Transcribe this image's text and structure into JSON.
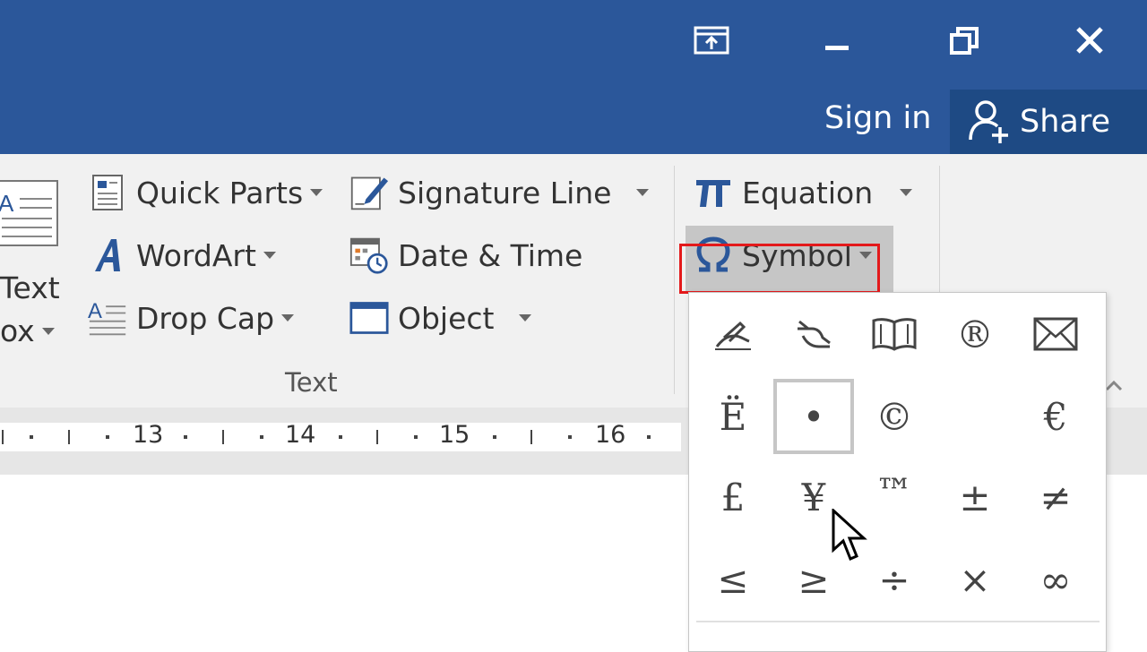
{
  "window": {
    "signin_label": "Sign in",
    "share_label": "Share"
  },
  "ribbon": {
    "text_box": {
      "line1": "Text",
      "line2": "ox"
    },
    "quick_parts": "Quick Parts",
    "wordart": "WordArt",
    "drop_cap": "Drop Cap",
    "signature_line": "Signature Line",
    "date_time": "Date & Time",
    "object": "Object",
    "equation": "Equation",
    "symbol": "Symbol",
    "group_label": "Text"
  },
  "ruler": {
    "marks": [
      "13",
      "14",
      "15",
      "16"
    ]
  },
  "symbol_gallery": {
    "symbols": [
      [
        "🖉",
        "🖎",
        "🕮",
        "®",
        "✉"
      ],
      [
        "Ë",
        "•",
        "©",
        "",
        "€"
      ],
      [
        "£",
        "¥",
        "™",
        "±",
        "≠"
      ],
      [
        "≤",
        "≥",
        "÷",
        "×",
        "∞"
      ]
    ],
    "selected": "•"
  },
  "colors": {
    "accent": "#2b579a",
    "highlight": "#e3191b"
  }
}
